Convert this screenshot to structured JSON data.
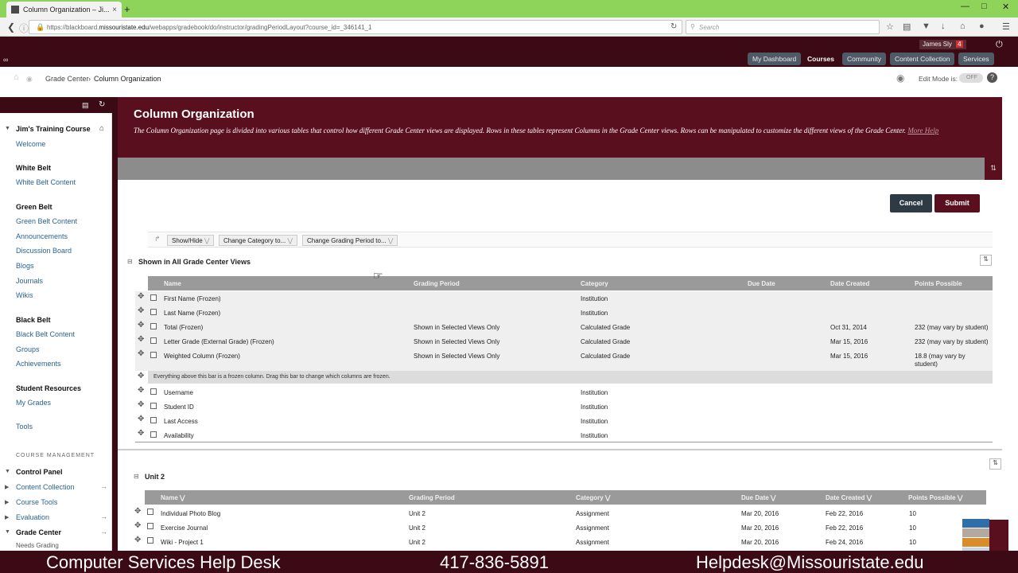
{
  "browser": {
    "tab_title": "Column Organization – Ji...",
    "tab_close": "×",
    "new_tab": "+",
    "url_host": "https://blackboard.",
    "url_domain": "missouristate.edu",
    "url_path": "/webapps/gradebook/do/instructor/gradingPeriodLayout?course_id=_346141_1",
    "search_placeholder": "Search"
  },
  "header": {
    "user_name": "James Sly",
    "notification_count": "4",
    "nav": [
      "My Dashboard",
      "Courses",
      "Community",
      "Content Collection",
      "Services"
    ],
    "active_nav": "Courses"
  },
  "breadcrumb": {
    "items": [
      "Grade Center",
      "Column Organization"
    ],
    "separator": "›",
    "edit_mode_label": "Edit Mode is:",
    "edit_mode_value": "OFF",
    "help": "?"
  },
  "sidebar": {
    "course_title": "Jim's Training Course",
    "groups": [
      {
        "head": "",
        "links": [
          "Welcome"
        ]
      },
      {
        "head": "White Belt",
        "links": [
          "White Belt Content"
        ]
      },
      {
        "head": "Green Belt",
        "links": [
          "Green Belt Content",
          "Announcements",
          "Discussion Board",
          "Blogs",
          "Journals",
          "Wikis"
        ]
      },
      {
        "head": "Black Belt",
        "links": [
          "Black Belt Content",
          "Groups",
          "Achievements"
        ]
      },
      {
        "head": "Student Resources",
        "links": [
          "My Grades"
        ]
      },
      {
        "head": "",
        "links": [
          "Tools"
        ]
      }
    ],
    "course_management_label": "COURSE MANAGEMENT",
    "management": [
      "Control Panel",
      "Content Collection",
      "Course Tools",
      "Evaluation",
      "Grade Center",
      "Needs Grading"
    ]
  },
  "page": {
    "title": "Column Organization",
    "description": "The Column Organization page is divided into various tables that control how different Grade Center views are displayed. Rows in these tables represent Columns in the Grade Center views. Rows can be manipulated to customize the different views of the Grade Center.",
    "more_help": "More Help",
    "cancel_label": "Cancel",
    "submit_label": "Submit"
  },
  "actions": [
    "Show/Hide",
    "Change Category to...",
    "Change Grading Period to..."
  ],
  "section1": {
    "title": "Shown in All Grade Center Views",
    "columns": [
      "Name",
      "Grading Period",
      "Category",
      "Due Date",
      "Date Created",
      "Points Possible"
    ],
    "frozen_rows": [
      {
        "name": "First Name (Frozen)",
        "period": "",
        "category": "Institution",
        "due": "",
        "created": "",
        "points": ""
      },
      {
        "name": "Last Name (Frozen)",
        "period": "",
        "category": "Institution",
        "due": "",
        "created": "",
        "points": ""
      },
      {
        "name": "Total (Frozen)",
        "period": "Shown in Selected Views Only",
        "category": "Calculated Grade",
        "due": "",
        "created": "Oct 31, 2014",
        "points": "232 (may vary by student)"
      },
      {
        "name": "Letter Grade (External Grade) (Frozen)",
        "period": "Shown in Selected Views Only",
        "category": "Calculated Grade",
        "due": "",
        "created": "Mar 15, 2016",
        "points": "232 (may vary by student)"
      },
      {
        "name": "Weighted Column (Frozen)",
        "period": "Shown in Selected Views Only",
        "category": "Calculated Grade",
        "due": "",
        "created": "Mar 15, 2016",
        "points": "18.8 (may vary by student)"
      }
    ],
    "frozen_note": "Everything above this bar is a frozen column. Drag this bar to change which columns are frozen.",
    "rows": [
      {
        "name": "Username",
        "category": "Institution"
      },
      {
        "name": "Student ID",
        "category": "Institution"
      },
      {
        "name": "Last Access",
        "category": "Institution"
      },
      {
        "name": "Availability",
        "category": "Institution"
      }
    ]
  },
  "section2": {
    "title": "Unit 2",
    "columns": [
      "Name",
      "Grading Period",
      "Category",
      "Due Date",
      "Date Created",
      "Points Possible"
    ],
    "rows": [
      {
        "name": "Individual Photo Blog",
        "period": "Unit 2",
        "category": "Assignment",
        "due": "Mar 20, 2016",
        "created": "Feb 22, 2016",
        "points": "10"
      },
      {
        "name": "Exercise Journal",
        "period": "Unit 2",
        "category": "Assignment",
        "due": "Mar 20, 2016",
        "created": "Feb 22, 2016",
        "points": "10"
      },
      {
        "name": "Wiki - Project 1",
        "period": "Unit 2",
        "category": "Assignment",
        "due": "Mar 20, 2016",
        "created": "Feb 24, 2016",
        "points": "10"
      }
    ]
  },
  "helpbar": {
    "desk": "Computer Services Help Desk",
    "phone": "417-836-5891",
    "email": "Helpdesk@Missouristate.edu"
  },
  "colors": {
    "maroon": "#5a0f1e",
    "dark_maroon": "#3b0a14",
    "tab_green": "#8fd45a",
    "link_blue": "#2a6495"
  }
}
